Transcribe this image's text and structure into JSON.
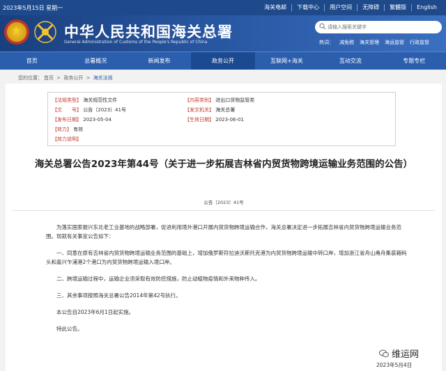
{
  "topbar": {
    "date": "2023年5月15日 星期一",
    "links": [
      "海关电邮",
      "下载中心",
      "用户空间",
      "无障碍",
      "繁體版",
      "English"
    ]
  },
  "header": {
    "title": "中华人民共和国海关总署",
    "subtitle": "General Administration of Customs of the People's Republic of China",
    "search_placeholder": "请输入搜索关键字",
    "hot_label": "热词：",
    "hot_words": [
      "减免税",
      "海关管理",
      "海运监管",
      "行政监管"
    ]
  },
  "nav": [
    "首页",
    "总署概况",
    "新闻发布",
    "政务公开",
    "互联网+海关",
    "互动交流",
    "专题专栏"
  ],
  "breadcrumb": {
    "prefix": "您的位置：",
    "items": [
      "首页",
      "政务公开",
      "海关法规"
    ],
    "sep": ">"
  },
  "meta": {
    "category_label": "【法规类型】",
    "category": "海关规范性文件",
    "content_label": "【内容类别】",
    "content": "进出口货物监管类",
    "docno_label": "【文　　号】",
    "docno": "公告〔2023〕41号",
    "issuer_label": "【发文机关】",
    "issuer": "海关总署",
    "pub_label": "【发布日期】",
    "pub": "2023-05-04",
    "eff_label": "【生效日期】",
    "eff": "2023-06-01",
    "validity_label": "【效力】",
    "validity": "有效",
    "note_label": "【效力说明】"
  },
  "article": {
    "title": "海关总署公告2023年第44号（关于进一步拓展吉林省内贸货物跨境运输业务范围的公告）",
    "docno": "公告〔2023〕41号",
    "paragraphs": [
      "为落实国家振兴东北老工业基地的战略部署，促进利用境外港口开展内贸货物跨境运输合作，海关总署决定进一步拓展吉林省内贸货物跨境运输业务范围。现就有关事宜公告如下：",
      "一、同意在原有吉林省内贸货物跨境运输业务范围的基础上，增加俄罗斯符拉迪沃斯托克港为内贸货物跨境运输中转口岸，增加浙江省舟山甬舟集装箱码头和嘉兴乍浦港2个港口为内贸货物跨境运输入境口岸。",
      "二、跨境运输过程中，运输企业须采取有效防控措施，防止动植物疫情和外来物种传入。",
      "三、其余事项按照海关总署公告2014年第42号执行。",
      "本公告自2023年6月1日起实施。",
      "特此公告。"
    ],
    "date": "2023年5月4日"
  },
  "watermark": "维运网",
  "colors": {
    "nav_blue": "#2b5fae",
    "header_blue": "#1a3f7e",
    "label_red": "#c0392b"
  }
}
